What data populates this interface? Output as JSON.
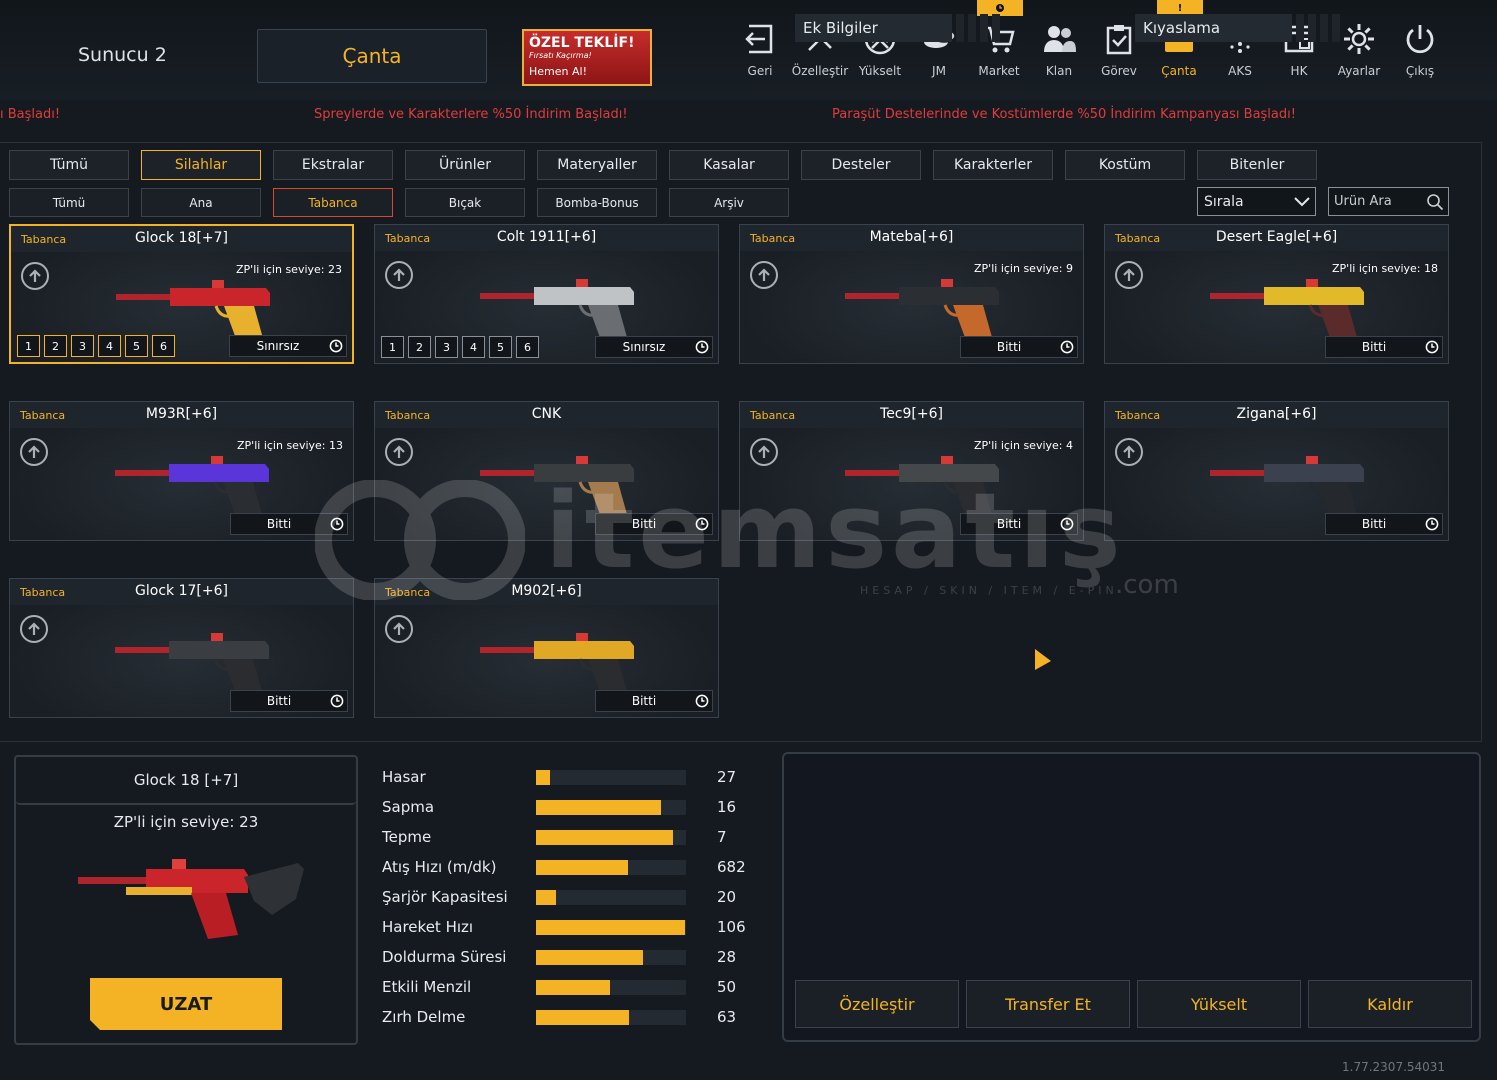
{
  "header": {
    "server": "Sunucu 2",
    "bag_title": "Çanta",
    "offer": {
      "line1": "ÖZEL TEKLİF!",
      "line2": "Fırsatı Kaçırma!",
      "line3": "Hemen Al!"
    },
    "nav": [
      {
        "label": "Geri",
        "icon": "back-icon"
      },
      {
        "label": "Özelleştir",
        "icon": "tools-icon"
      },
      {
        "label": "Yükselt",
        "icon": "upgrade-icon"
      },
      {
        "label": "JM",
        "icon": "coins-icon"
      },
      {
        "label": "Market",
        "icon": "cart-icon"
      },
      {
        "label": "Klan",
        "icon": "clan-icon"
      },
      {
        "label": "Görev",
        "icon": "task-icon"
      },
      {
        "label": "Çanta",
        "icon": "bag-icon"
      },
      {
        "label": "AKS",
        "icon": "dots-icon"
      },
      {
        "label": "HK",
        "icon": "window-icon"
      },
      {
        "label": "Ayarlar",
        "icon": "gear-icon"
      },
      {
        "label": "Çıkış",
        "icon": "power-icon"
      }
    ],
    "badges": {
      "market": "clock",
      "bag": "!"
    }
  },
  "ticker": [
    "ı Başladı!",
    "Spreylerde ve Karakterlere %50 İndirim Başladı!",
    "Paraşüt Destelerinde ve Kostümlerde %50 İndirim Kampanyası Başladı!"
  ],
  "tabs": [
    "Tümü",
    "Silahlar",
    "Ekstralar",
    "Ürünler",
    "Materyaller",
    "Kasalar",
    "Desteler",
    "Karakterler",
    "Kostüm",
    "Bitenler"
  ],
  "selected_tab": "Silahlar",
  "subtabs": [
    "Tümü",
    "Ana",
    "Tabanca",
    "Bıçak",
    "Bomba-Bonus",
    "Arşiv"
  ],
  "selected_subtab": "Tabanca",
  "sort": {
    "label": "Sırala"
  },
  "search": {
    "placeholder": "Ürün Ara"
  },
  "items": [
    {
      "category": "Tabanca",
      "name": "Glock 18[+7]",
      "zp": "ZP'li için seviye: 23",
      "status": "Sınırsız",
      "levels": [
        "1",
        "2",
        "3",
        "4",
        "5",
        "6"
      ],
      "selected": true,
      "colors": [
        "#c9252a",
        "#e7b12d"
      ]
    },
    {
      "category": "Tabanca",
      "name": "Colt 1911[+6]",
      "zp": "",
      "status": "Sınırsız",
      "levels": [
        "1",
        "2",
        "3",
        "4",
        "5",
        "6"
      ],
      "selected": false,
      "colors": [
        "#bfc3c6",
        "#6a6e72"
      ]
    },
    {
      "category": "Tabanca",
      "name": "Mateba[+6]",
      "zp": "ZP'li için seviye: 9",
      "status": "Bitti",
      "levels": [],
      "selected": false,
      "colors": [
        "#2b2f33",
        "#c4682c"
      ]
    },
    {
      "category": "Tabanca",
      "name": "Desert Eagle[+6]",
      "zp": "ZP'li için seviye: 18",
      "status": "Bitti",
      "levels": [],
      "selected": false,
      "colors": [
        "#e2b929",
        "#5b2a2a"
      ]
    },
    {
      "category": "Tabanca",
      "name": "M93R[+6]",
      "zp": "ZP'li için seviye: 13",
      "status": "Bitti",
      "levels": [],
      "selected": false,
      "colors": [
        "#5a35d9",
        "#2a2d31"
      ]
    },
    {
      "category": "Tabanca",
      "name": "CNK",
      "zp": "",
      "status": "Bitti",
      "levels": [],
      "selected": false,
      "colors": [
        "#3a3d40",
        "#a47b4f"
      ]
    },
    {
      "category": "Tabanca",
      "name": "Tec9[+6]",
      "zp": "ZP'li için seviye: 4",
      "status": "Bitti",
      "levels": [],
      "selected": false,
      "colors": [
        "#45484b",
        "#2a2c2f"
      ]
    },
    {
      "category": "Tabanca",
      "name": "Zigana[+6]",
      "zp": "",
      "status": "Bitti",
      "levels": [],
      "selected": false,
      "colors": [
        "#3c4150",
        "#25282d"
      ]
    },
    {
      "category": "Tabanca",
      "name": "Glock 17[+6]",
      "zp": "",
      "status": "Bitti",
      "levels": [],
      "selected": false,
      "colors": [
        "#3a3d41",
        "#2a2c2f"
      ]
    },
    {
      "category": "Tabanca",
      "name": "M902[+6]",
      "zp": "",
      "status": "Bitti",
      "levels": [],
      "selected": false,
      "colors": [
        "#e1a825",
        "#2a2c2f"
      ]
    }
  ],
  "detail": {
    "name": "Glock 18 [+7]",
    "zp": "ZP'li için seviye: 23",
    "extend_label": "UZAT",
    "stats": [
      {
        "name": "Hasar",
        "value": "27",
        "fill": 0.09
      },
      {
        "name": "Sapma",
        "value": "16",
        "fill": 0.83
      },
      {
        "name": "Tepme",
        "value": "7",
        "fill": 0.91
      },
      {
        "name": "Atış Hızı (m/dk)",
        "value": "682",
        "fill": 0.61
      },
      {
        "name": "Şarjör Kapasitesi",
        "value": "20",
        "fill": 0.13
      },
      {
        "name": "Hareket Hızı",
        "value": "106",
        "fill": 0.99
      },
      {
        "name": "Doldurma Süresi",
        "value": "28",
        "fill": 0.71
      },
      {
        "name": "Etkili Menzil",
        "value": "50",
        "fill": 0.49
      },
      {
        "name": "Zırh Delme",
        "value": "63",
        "fill": 0.62
      }
    ]
  },
  "info": {
    "tab1": "Ek Bilgiler",
    "tab2": "Kıyaslama",
    "actions": [
      "Özelleştir",
      "Transfer Et",
      "Yükselt",
      "Kaldır"
    ]
  },
  "watermark": {
    "main": "itemsatış",
    "sub": "HESAP / SKIN / ITEM / E-PIN",
    "com": ".com"
  },
  "version": "1.77.2307.54031",
  "colors": {
    "accent": "#f4b324",
    "ticker": "#e23b3b",
    "background": "#151a20"
  }
}
